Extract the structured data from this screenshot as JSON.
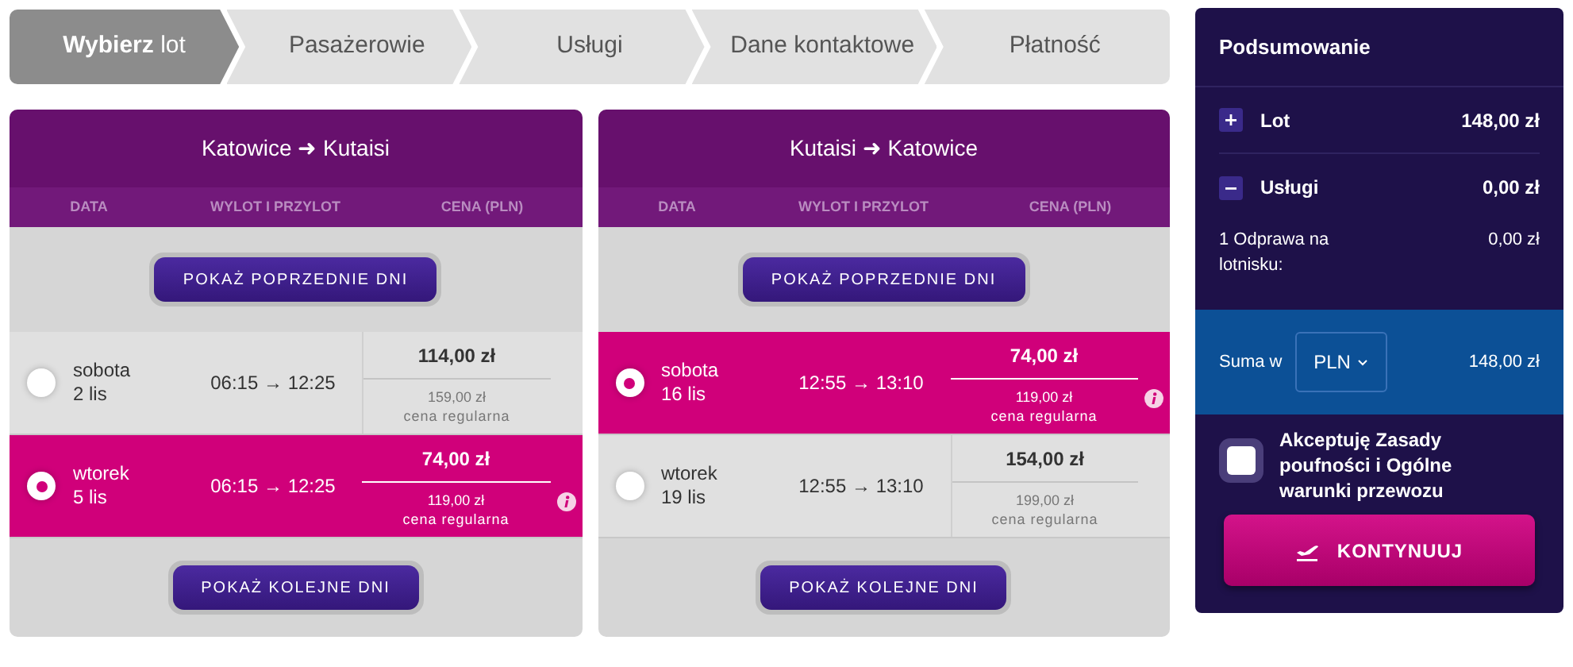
{
  "steps": [
    {
      "label": "**Wybierz** lot",
      "selected": true
    },
    {
      "label": "Pasażerowie",
      "selected": false
    },
    {
      "label": "Usługi",
      "selected": false
    },
    {
      "label": "Dane kontaktowe",
      "selected": false
    },
    {
      "label": "Płatność",
      "selected": false
    }
  ],
  "flights": [
    {
      "title": "Katowice ➜ Kutaisi",
      "columns": [
        "DATA",
        "WYLOT I PRZYLOT",
        "CENA (PLN)"
      ],
      "prev_button": "POKAŻ POPRZEDNIE DNI",
      "next_button": "POKAŻ KOLEJNE DNI",
      "rows": [
        {
          "day": "sobota",
          "date": "2 lis",
          "times": "06:15 → 12:25",
          "price": "114,00 zł",
          "regular_price": "159,00 zł",
          "regular_label": "cena regularna",
          "selected": false
        },
        {
          "day": "wtorek",
          "date": "5 lis",
          "times": "06:15 → 12:25",
          "price": "74,00 zł",
          "regular_price": "119,00 zł",
          "regular_label": "cena regularna",
          "selected": true
        }
      ]
    },
    {
      "title": "Kutaisi ➜ Katowice",
      "columns": [
        "DATA",
        "WYLOT I PRZYLOT",
        "CENA (PLN)"
      ],
      "prev_button": "POKAŻ POPRZEDNIE DNI",
      "next_button": "POKAŻ KOLEJNE DNI",
      "rows": [
        {
          "day": "sobota",
          "date": "16 lis",
          "times": "12:55 → 13:10",
          "price": "74,00 zł",
          "regular_price": "119,00 zł",
          "regular_label": "cena regularna",
          "selected": true
        },
        {
          "day": "wtorek",
          "date": "19 lis",
          "times": "12:55 → 13:10",
          "price": "154,00 zł",
          "regular_price": "199,00 zł",
          "regular_label": "cena regularna",
          "selected": false
        }
      ]
    }
  ],
  "summary": {
    "title": "Podsumowanie",
    "sections": [
      {
        "label": "Lot",
        "amount": "148,00 zł",
        "expanded": false
      },
      {
        "label": "Usługi",
        "amount": "0,00 zł",
        "expanded": true
      }
    ],
    "items": [
      {
        "label": "1 Odprawa na lotnisku:",
        "amount": "0,00 zł"
      }
    ],
    "total_label": "Suma w",
    "currency": "PLN",
    "total": "148,00 zł",
    "terms": {
      "label": "Akceptuję Zasady poufności i Ogólne warunki przewozu",
      "checked": false
    },
    "continue_button": "KONTYNUUJ"
  }
}
